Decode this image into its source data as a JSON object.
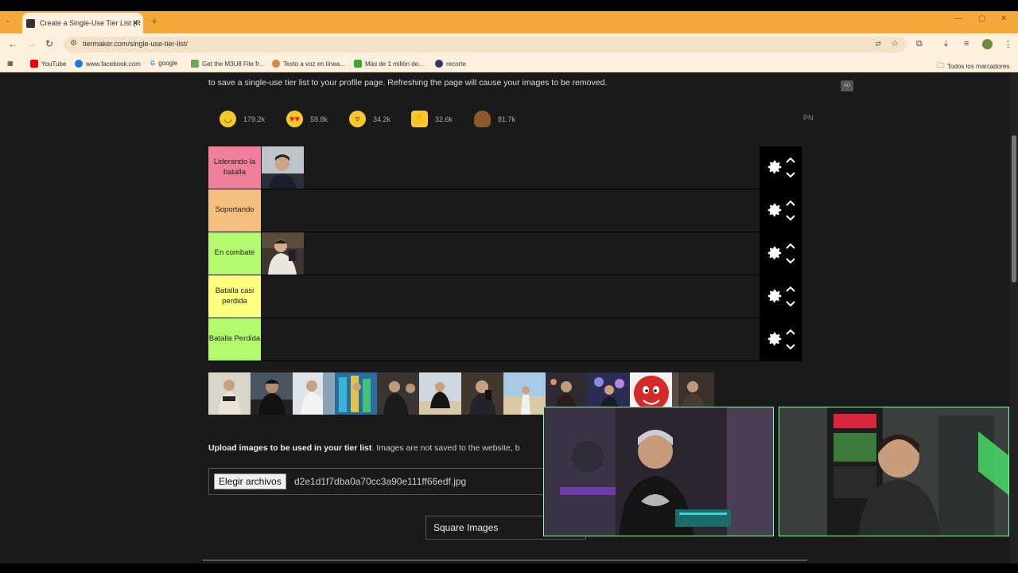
{
  "browser": {
    "tab_title": "Create a Single-Use Tier List (R",
    "url": "tiermaker.com/single-use-tier-list/",
    "bookmarks": [
      "YouTube",
      "www.facebook.com",
      "google",
      "Get the M3U8 File fr...",
      "Texto a voz en línea...",
      "Más de 1 millón de...",
      "recorte"
    ],
    "all_bookmarks": "Todos los marcadores"
  },
  "page": {
    "intro_text": "to save a single-use tier list to your profile page. Refreshing the page will cause your images to be removed.",
    "ad_badge": "AD",
    "pn_label": "PN",
    "reactions": [
      {
        "icon": "smile-emoji-icon",
        "count": "179.2k",
        "color": "#f7c82c"
      },
      {
        "icon": "heart-eyes-emoji-icon",
        "count": "59.8k",
        "color": "#f7c82c"
      },
      {
        "icon": "laughing-emoji-icon",
        "count": "34.2k",
        "color": "#f7c82c"
      },
      {
        "icon": "raised-hands-emoji-icon",
        "count": "32.6k",
        "color": "#f7c82c"
      },
      {
        "icon": "poop-emoji-icon",
        "count": "81.7k",
        "color": "#8b5a2b"
      }
    ],
    "tiers": [
      {
        "label": "Liderando la batalla",
        "color": "#f07f9b"
      },
      {
        "label": "Soportando",
        "color": "#f5bf7f"
      },
      {
        "label": "En combate",
        "color": "#b3f96e"
      },
      {
        "label": "Batalla casi perdida",
        "color": "#ffff7f"
      },
      {
        "label": "Batalla Perdida",
        "color": "#b3f96e"
      }
    ],
    "upload_bold": "Upload images to be used in your tier list",
    "upload_rest": ". Images are not saved to the website, b",
    "choose_files": "Elegir archivos",
    "file_name": "d2e1d1f7dba0a70cc3a90e111ff66edf.jpg",
    "square_images": "Square Images"
  }
}
